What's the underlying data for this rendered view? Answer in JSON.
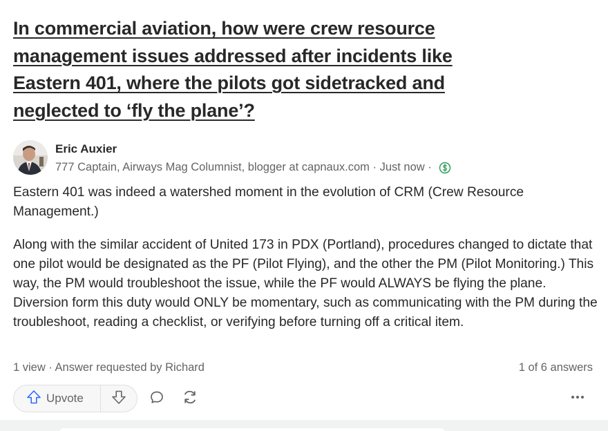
{
  "question": {
    "title": "In commercial aviation, how were crew resource management issues addressed after incidents like Eastern 401, where the pilots got sidetracked and neglected to ‘fly the plane’?"
  },
  "author": {
    "name": "Eric Auxier",
    "credential": "777 Captain, Airways Mag Columnist, blogger at capnaux.com",
    "timestamp": "Just now",
    "separator": " · ",
    "badge_icon": "dollar-circle-icon"
  },
  "answer": {
    "paragraphs": [
      "Eastern 401 was indeed a watershed moment in the evolution of CRM (Crew Resource Management.)",
      "Along with the similar accident of United 173 in PDX (Portland), procedures changed to dictate that one pilot would be designated as the PF (Pilot Flying), and the other the PM (Pilot Monitoring.) This way, the PM would troubleshoot the issue, while the PF would ALWAYS be flying the plane. Diversion form this duty would ONLY be momentary, such as communicating with the PM during the troubleshoot, reading a checklist, or verifying before turning off a critical item."
    ]
  },
  "footer": {
    "meta": "1 view · Answer requested by Richard",
    "answers_count": "1 of 6 answers"
  },
  "actions": {
    "upvote_label": "Upvote",
    "icons": [
      "upvote-arrow-icon",
      "downvote-arrow-icon",
      "comment-icon",
      "share-icon",
      "more-icon"
    ]
  },
  "colors": {
    "accent_green": "#2e9f5b",
    "upvote_blue": "#2e69ff",
    "muted_text": "#636466"
  }
}
